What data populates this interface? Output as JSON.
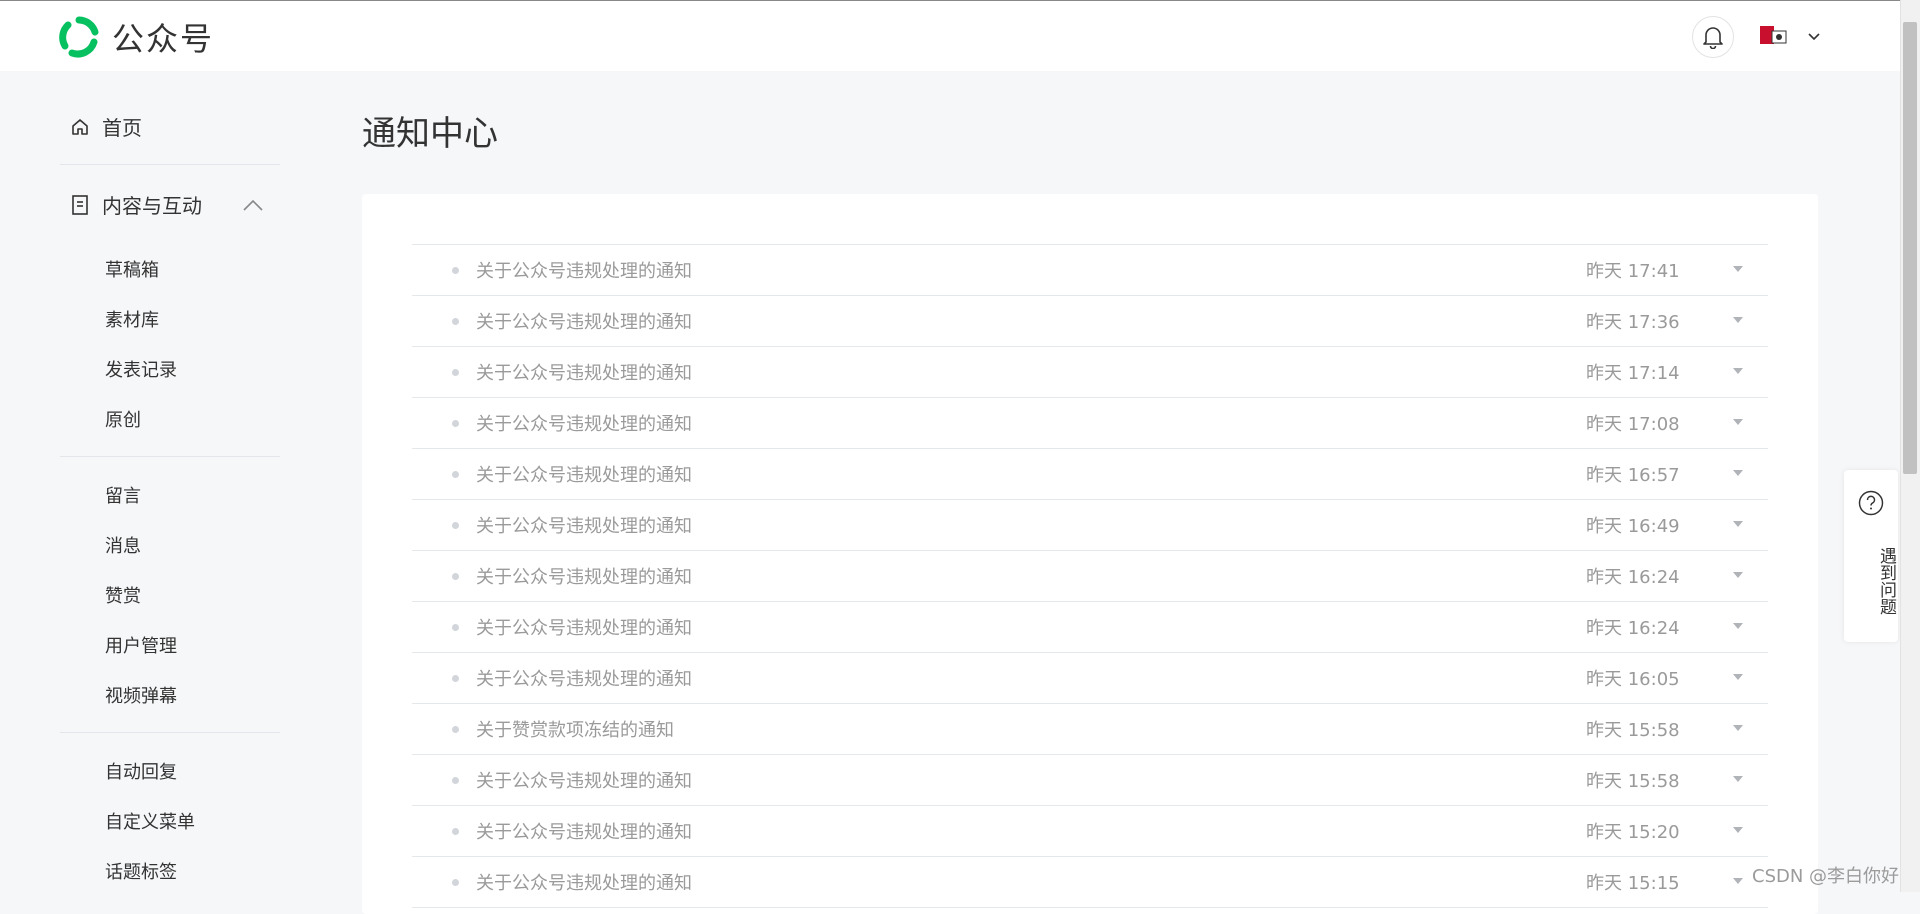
{
  "header": {
    "brand": "公众号",
    "accent": "#07c160"
  },
  "sidebar": {
    "home": "首页",
    "section": "内容与互动",
    "group1": [
      "草稿箱",
      "素材库",
      "发表记录",
      "原创"
    ],
    "group2": [
      "留言",
      "消息",
      "赞赏",
      "用户管理",
      "视频弹幕"
    ],
    "group3": [
      "自动回复",
      "自定义菜单",
      "话题标签"
    ]
  },
  "main": {
    "title": "通知中心",
    "notices": [
      {
        "title": "关于公众号违规处理的通知",
        "time": "昨天 17:41"
      },
      {
        "title": "关于公众号违规处理的通知",
        "time": "昨天 17:36"
      },
      {
        "title": "关于公众号违规处理的通知",
        "time": "昨天 17:14"
      },
      {
        "title": "关于公众号违规处理的通知",
        "time": "昨天 17:08"
      },
      {
        "title": "关于公众号违规处理的通知",
        "time": "昨天 16:57"
      },
      {
        "title": "关于公众号违规处理的通知",
        "time": "昨天 16:49"
      },
      {
        "title": "关于公众号违规处理的通知",
        "time": "昨天 16:24"
      },
      {
        "title": "关于公众号违规处理的通知",
        "time": "昨天 16:24"
      },
      {
        "title": "关于公众号违规处理的通知",
        "time": "昨天 16:05"
      },
      {
        "title": "关于赞赏款项冻结的通知",
        "time": "昨天 15:58"
      },
      {
        "title": "关于公众号违规处理的通知",
        "time": "昨天 15:58"
      },
      {
        "title": "关于公众号违规处理的通知",
        "time": "昨天 15:20"
      },
      {
        "title": "关于公众号违规处理的通知",
        "time": "昨天 15:15"
      }
    ]
  },
  "help": {
    "label": "遇到问题"
  },
  "watermark": "CSDN @李白你好"
}
